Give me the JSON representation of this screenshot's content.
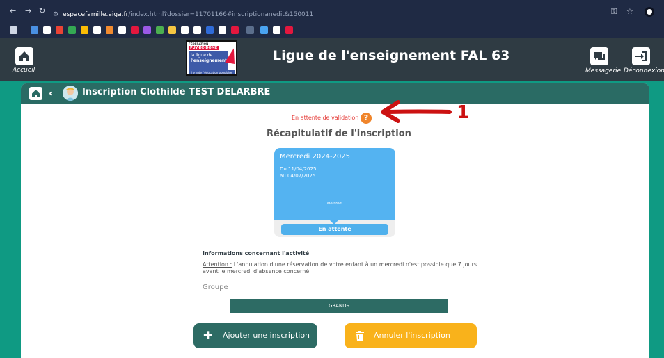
{
  "browser": {
    "url_host": "espacefamille.aiga.fr",
    "url_rest": "/index.html?dossier=11701166#inscriptionanedit&150011"
  },
  "header": {
    "title": "Ligue de l'enseignement FAL 63",
    "home_label": "Accueil",
    "messages_label": "Messagerie",
    "logout_label": "Déconnexion",
    "logo": {
      "line1": "FÉDÉRATION",
      "line2": "PUY-DE-DÔME",
      "line3a": "la ligue de",
      "line3b": "l'enseignement",
      "line4": "Il y a de l'éducation populaire"
    }
  },
  "page": {
    "title": "Inscription Clothilde TEST DELARBRE",
    "status_text": "En attente de validation",
    "annotation_number": "1",
    "recap_title": "Récapitulatif de l'inscription"
  },
  "card": {
    "name": "Mercredi 2024-2025",
    "from": "Du 11/04/2025",
    "to": "au 04/07/2025",
    "day": "Mercredi",
    "status": "En attente"
  },
  "info": {
    "title": "Informations concernant l'activité",
    "attention_label": "Attention :",
    "text": " L'annulation d'une réservation de votre enfant à un mercredi n'est possible que 7 jours avant le mercredi d'absence concerné.",
    "group_label": "Groupe",
    "group_value": "GRANDS"
  },
  "actions": {
    "add_label": "Ajouter une inscription",
    "cancel_label": "Annuler l'inscription"
  },
  "colors": {
    "header_bg": "#2f3b43",
    "page_bg": "#0f9a83",
    "teal_dark": "#2d6b64",
    "card_blue": "#54b3f1",
    "warning_orange": "#f9b21b",
    "status_red": "#e53935"
  }
}
